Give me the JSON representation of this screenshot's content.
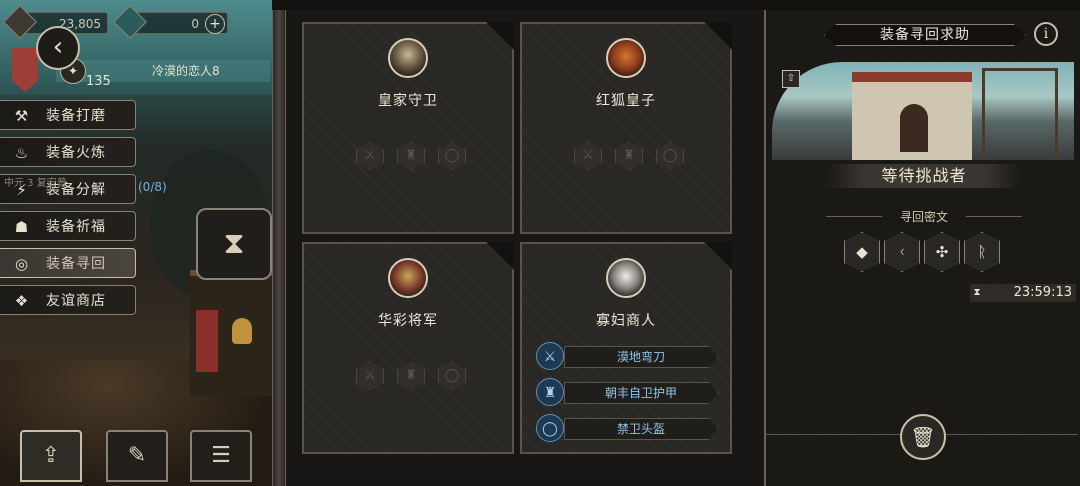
{
  "resources": {
    "coins": "23,805",
    "gems": "0"
  },
  "player": {
    "name": "冷漠的恋人8",
    "level": "135"
  },
  "menu": [
    {
      "label": "装备打磨",
      "icon": "hammer-icon",
      "glyph": "⚒"
    },
    {
      "label": "装备火炼",
      "icon": "flame-icon",
      "glyph": "♨"
    },
    {
      "label": "装备分解",
      "icon": "decompose-icon",
      "glyph": "⚡"
    },
    {
      "label": "装备祈福",
      "icon": "pray-icon",
      "glyph": "☗"
    },
    {
      "label": "装备寻回",
      "icon": "retrieve-icon",
      "glyph": "◎"
    },
    {
      "label": "友谊商店",
      "icon": "fox-icon",
      "glyph": "❖"
    }
  ],
  "progress_text": "(0/8)",
  "hidden_text": "中元 3 复宏普",
  "cards": [
    {
      "name": "皇家守卫"
    },
    {
      "name": "红狐皇子"
    },
    {
      "name": "华彩将军"
    },
    {
      "name": "寡妇商人",
      "items": [
        "漠地弯刀",
        "朝丰自卫护甲",
        "禁卫头盔"
      ]
    }
  ],
  "right_panel": {
    "title": "装备寻回求助",
    "info": "i",
    "status": "等待挑战者",
    "subtitle": "寻回密文",
    "timer": "23:59:13"
  },
  "colors": {
    "accent_blue": "#8fc6ea",
    "frame": "#8a8272",
    "background": "#141210"
  }
}
